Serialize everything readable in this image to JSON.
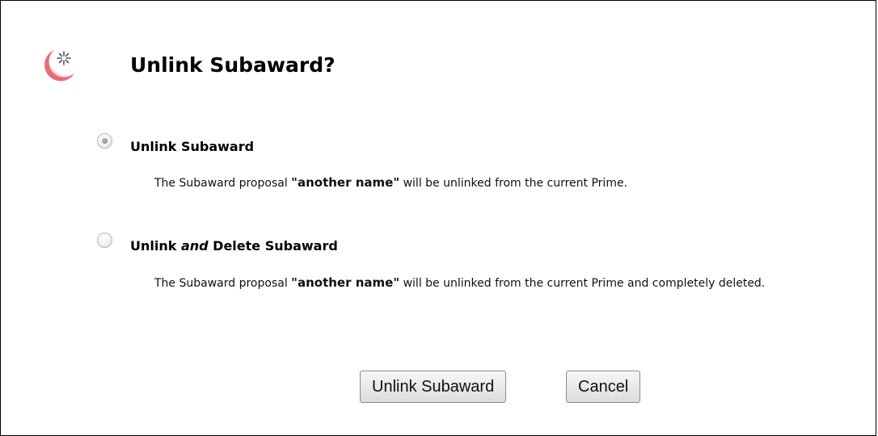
{
  "dialog": {
    "title": "Unlink Subaward?",
    "icon": "spinner-crescent-icon",
    "accent_color": "#e0505a",
    "options": [
      {
        "label": "Unlink Subaward",
        "selected": true,
        "desc_prefix": "The Subaward proposal ",
        "desc_name": "\"another name\"",
        "desc_suffix": " will be unlinked from the current Prime."
      },
      {
        "label_before": "Unlink ",
        "label_em": "and",
        "label_after": " Delete Subaward",
        "selected": false,
        "desc_prefix": "The Subaward proposal ",
        "desc_name": "\"another name\"",
        "desc_suffix": " will be unlinked from the current Prime and completely deleted."
      }
    ],
    "buttons": {
      "confirm_label": "Unlink Subaward",
      "cancel_label": "Cancel"
    }
  }
}
